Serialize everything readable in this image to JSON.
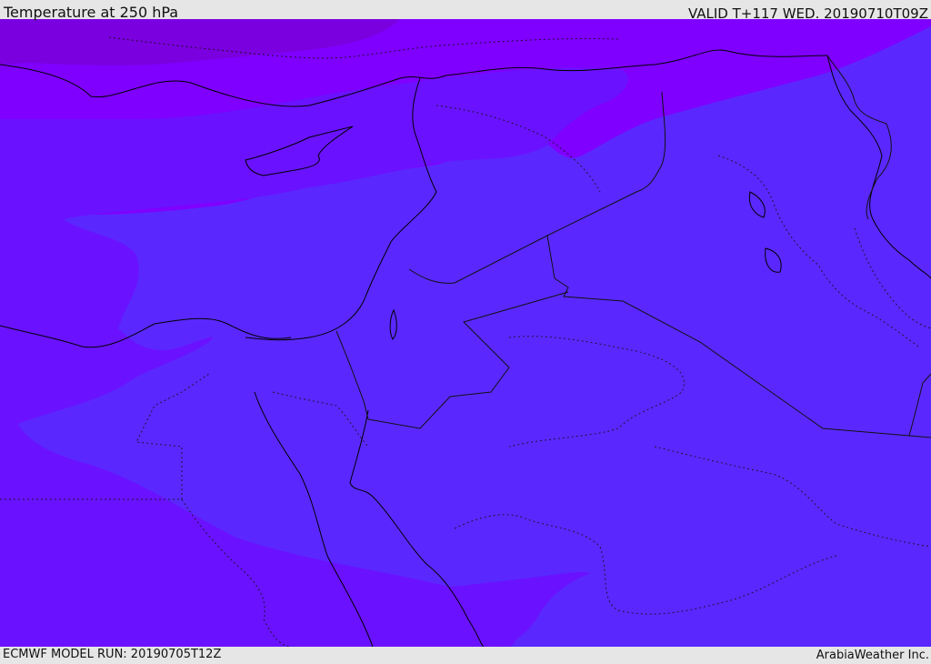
{
  "header": {
    "title": "Temperature at 250 hPa",
    "valid": "VALID T+117 WED. 20190710T09Z"
  },
  "footer": {
    "model_run": "ECMWF MODEL RUN: 20190705T12Z",
    "credit": "ArabiaWeather Inc."
  },
  "colors": {
    "band_coldest": "#7a00d9",
    "band_cold": "#7f00ff",
    "band_mid": "#6a12ff",
    "band_warm": "#5a28ff",
    "coast_line": "#000000",
    "border_line": "#111111"
  },
  "layers": [
    "temperature-fill",
    "coastlines",
    "country-borders",
    "admin-borders"
  ]
}
